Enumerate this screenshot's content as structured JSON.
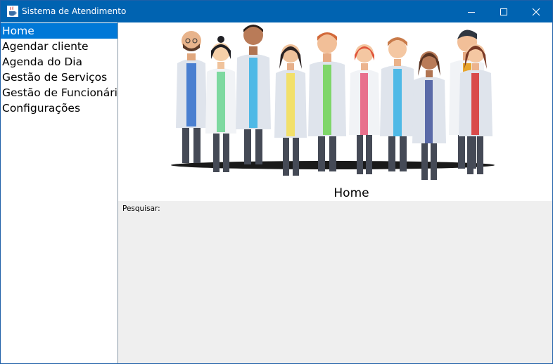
{
  "window": {
    "title": "Sistema de Atendimento",
    "icon": "java-cup-icon",
    "controls": [
      "minimize-icon",
      "maximize-icon",
      "close-icon"
    ],
    "titlebar_color": "#0063b1"
  },
  "sidebar": {
    "items": [
      {
        "label": "Home",
        "selected": true
      },
      {
        "label": "Agendar cliente",
        "selected": false
      },
      {
        "label": "Agenda do Dia",
        "selected": false
      },
      {
        "label": "Gestão de Serviços",
        "selected": false
      },
      {
        "label": "Gestão de Funcionários",
        "selected": false
      },
      {
        "label": "Configurações",
        "selected": false
      }
    ],
    "selection_color": "#0078d7"
  },
  "main": {
    "banner_icon": "medical-team-illustration",
    "heading": "Home",
    "search_label": "Pesquisar:"
  }
}
